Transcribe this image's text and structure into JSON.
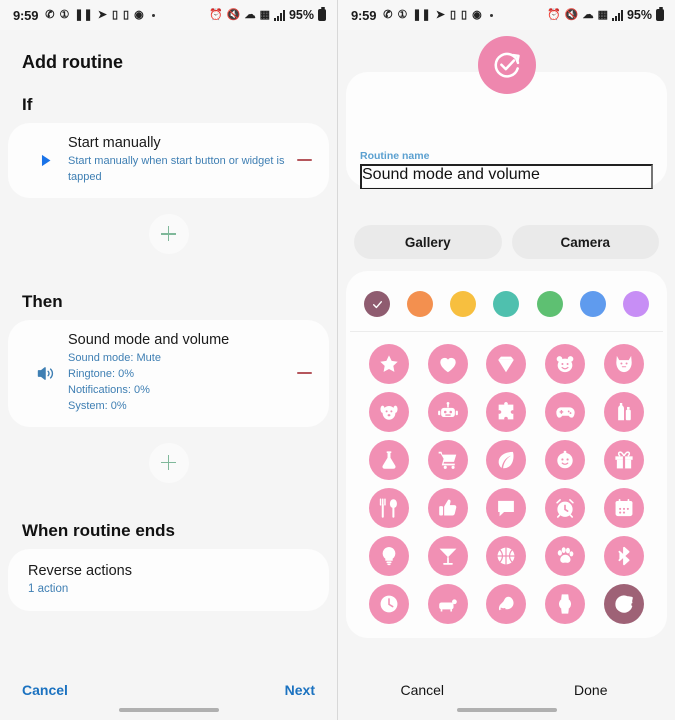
{
  "status_bar": {
    "time": "9:59",
    "left_icons": [
      "whatsapp-icon",
      "circle-b-icon",
      "pause-icon",
      "telegram-icon",
      "message-icon",
      "message-icon",
      "clock-play-icon",
      "dot-icon"
    ],
    "right_icons": [
      "alarm-icon",
      "mute-icon",
      "wifi-icon",
      "network-icon",
      "signal-icon"
    ],
    "battery": "95%"
  },
  "left_screen": {
    "page_title": "Add routine",
    "if_section": {
      "heading": "If",
      "card": {
        "icon": "play-icon",
        "title": "Start manually",
        "subtitle": "Start manually when start button or widget is tapped",
        "remove_label": "remove"
      },
      "add_label": "add-condition"
    },
    "then_section": {
      "heading": "Then",
      "card": {
        "icon": "volume-icon",
        "title": "Sound mode and volume",
        "details": [
          "Sound mode: Mute",
          "Ringtone: 0%",
          "Notifications: 0%",
          "System: 0%"
        ],
        "remove_label": "remove"
      },
      "add_label": "add-action"
    },
    "end_section": {
      "heading": "When routine ends",
      "card": {
        "title": "Reverse actions",
        "subtitle": "1 action"
      }
    },
    "footer": {
      "cancel": "Cancel",
      "next": "Next"
    }
  },
  "right_screen": {
    "hero_icon": "routine-check-icon",
    "hero_color": "#ee87ae",
    "name_field": {
      "label": "Routine name",
      "value": "Sound mode and volume",
      "placeholder": "Routine name"
    },
    "source_buttons": [
      {
        "label": "Gallery",
        "name": "gallery-button"
      },
      {
        "label": "Camera",
        "name": "camera-button"
      }
    ],
    "colors": [
      {
        "hex": "#8f5c70",
        "selected": true
      },
      {
        "hex": "#f3904f",
        "selected": false
      },
      {
        "hex": "#f7bf3f",
        "selected": false
      },
      {
        "hex": "#4fc0ae",
        "selected": false
      },
      {
        "hex": "#5ec072",
        "selected": false
      },
      {
        "hex": "#5f9bee",
        "selected": false
      },
      {
        "hex": "#c78ef5",
        "selected": false
      }
    ],
    "icons": [
      {
        "name": "star-icon",
        "selected": false
      },
      {
        "name": "heart-icon",
        "selected": false
      },
      {
        "name": "diamond-icon",
        "selected": false
      },
      {
        "name": "bear-icon",
        "selected": false
      },
      {
        "name": "cat-icon",
        "selected": false
      },
      {
        "name": "dog-icon",
        "selected": false
      },
      {
        "name": "robot-icon",
        "selected": false
      },
      {
        "name": "puzzle-icon",
        "selected": false
      },
      {
        "name": "gamepad-icon",
        "selected": false
      },
      {
        "name": "cosmetics-icon",
        "selected": false
      },
      {
        "name": "flask-icon",
        "selected": false
      },
      {
        "name": "shopping-cart-icon",
        "selected": false
      },
      {
        "name": "leaf-icon",
        "selected": false
      },
      {
        "name": "baby-icon",
        "selected": false
      },
      {
        "name": "gift-icon",
        "selected": false
      },
      {
        "name": "cutlery-icon",
        "selected": false
      },
      {
        "name": "thumbs-up-icon",
        "selected": false
      },
      {
        "name": "chat-bubble-icon",
        "selected": false
      },
      {
        "name": "alarm-clock-icon",
        "selected": false
      },
      {
        "name": "calendar-icon",
        "selected": false
      },
      {
        "name": "lightbulb-icon",
        "selected": false
      },
      {
        "name": "cocktail-icon",
        "selected": false
      },
      {
        "name": "basketball-icon",
        "selected": false
      },
      {
        "name": "paw-icon",
        "selected": false
      },
      {
        "name": "bluetooth-icon",
        "selected": false
      },
      {
        "name": "clock-icon",
        "selected": false
      },
      {
        "name": "sofa-icon",
        "selected": false
      },
      {
        "name": "mask-icon",
        "selected": false
      },
      {
        "name": "watch-icon",
        "selected": false
      },
      {
        "name": "routine-check-icon",
        "selected": true
      }
    ],
    "footer": {
      "cancel": "Cancel",
      "done": "Done"
    }
  }
}
